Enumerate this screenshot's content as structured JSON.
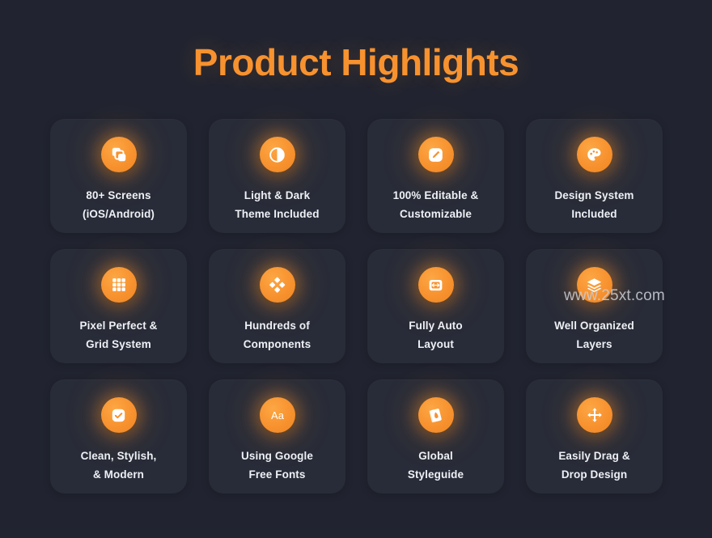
{
  "page": {
    "title": "Product Highlights",
    "background_color": "#212430",
    "accent_color": "#F7922F",
    "card_color": "#282c38",
    "text_color": "#eef0f5"
  },
  "watermark": {
    "text": "www.25xt.com"
  },
  "cards": [
    {
      "icon": "copy-layers-icon",
      "line1": "80+ Screens",
      "line2": "(iOS/Android)"
    },
    {
      "icon": "contrast-circle-icon",
      "line1": "Light & Dark",
      "line2": "Theme Included"
    },
    {
      "icon": "pencil-square-icon",
      "line1": "100% Editable &",
      "line2": "Customizable"
    },
    {
      "icon": "paint-palette-icon",
      "line1": "Design System",
      "line2": "Included"
    },
    {
      "icon": "grid-dots-icon",
      "line1": "Pixel Perfect &",
      "line2": "Grid System"
    },
    {
      "icon": "four-diamonds-icon",
      "line1": "Hundreds of",
      "line2": "Components"
    },
    {
      "icon": "auto-layout-icon",
      "line1": "Fully Auto",
      "line2": "Layout"
    },
    {
      "icon": "layers-stack-icon",
      "line1": "Well Organized",
      "line2": "Layers"
    },
    {
      "icon": "checkbox-check-icon",
      "line1": "Clean, Stylish,",
      "line2": "& Modern"
    },
    {
      "icon": "typography-aa-icon",
      "line1": "Using Google",
      "line2": "Free Fonts"
    },
    {
      "icon": "styleguide-book-icon",
      "line1": "Global",
      "line2": "Styleguide"
    },
    {
      "icon": "move-arrows-icon",
      "line1": "Easily Drag &",
      "line2": "Drop Design"
    }
  ]
}
